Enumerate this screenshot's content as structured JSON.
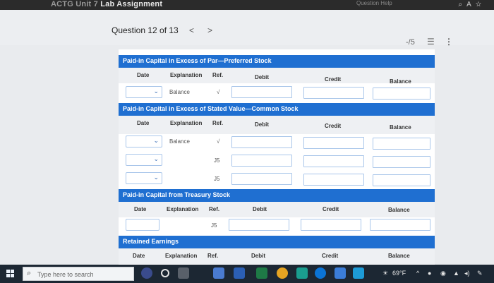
{
  "window": {
    "title_faded": "ACTG Unit 7",
    "title": "Lab Assignment",
    "center_faded": "Question Help"
  },
  "question": {
    "label": "Question 12 of 13",
    "prev": "<",
    "next": ">",
    "score": "-/5"
  },
  "columns": {
    "date": "Date",
    "explanation": "Explanation",
    "ref": "Ref.",
    "debit": "Debit",
    "credit": "Credit",
    "balance": "Balance"
  },
  "sections": {
    "preferred": {
      "title": "Paid-in Capital in Excess of Par—Preferred Stock",
      "balance_label": "Balance",
      "check": "√"
    },
    "stated": {
      "title": "Paid-in Capital in Excess of Stated Value—Common Stock",
      "balance_label": "Balance",
      "check": "√",
      "ref1": "J5",
      "ref2": "J5"
    },
    "treasury": {
      "title": "Paid-in Capital from Treasury Stock",
      "ref1": "J5"
    },
    "retained": {
      "title": "Retained Earnings"
    }
  },
  "taskbar": {
    "search_placeholder": "Type here to search",
    "temperature": "69°F"
  },
  "colors": {
    "section_header": "#1f6fd1",
    "input_border": "#a9c6ea"
  }
}
